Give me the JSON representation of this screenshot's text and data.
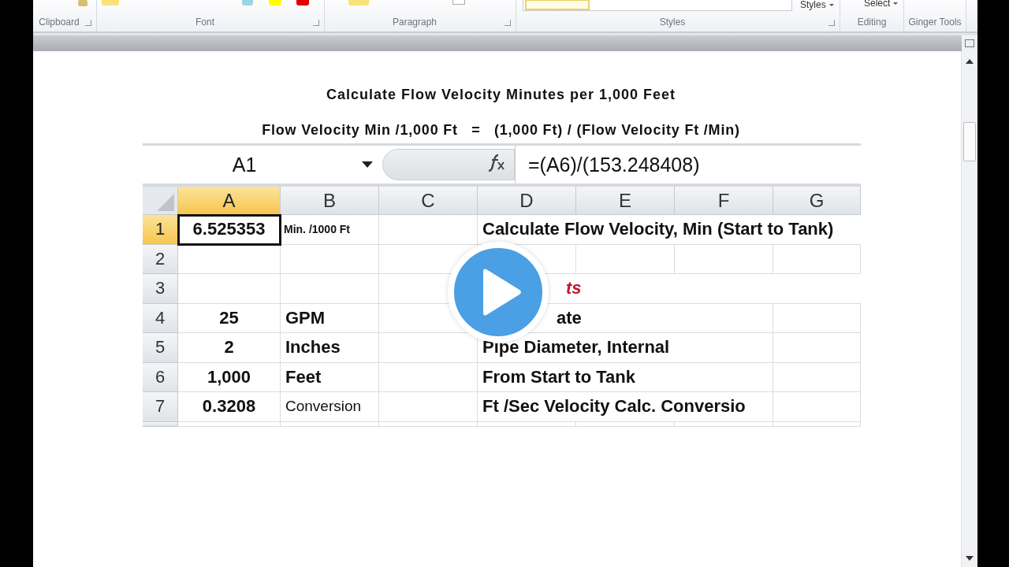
{
  "ribbon": {
    "top_buttons": [
      {
        "label": "Styles"
      },
      {
        "label": "Select"
      }
    ],
    "groups": [
      {
        "label": "Clipboard",
        "launcher": true
      },
      {
        "label": "Font",
        "launcher": true
      },
      {
        "label": "Paragraph",
        "launcher": true
      },
      {
        "label": "Styles",
        "launcher": true
      },
      {
        "label": "Editing",
        "launcher": false
      },
      {
        "label": "Ginger Tools",
        "launcher": false
      }
    ]
  },
  "document": {
    "title": "Calculate Flow Velocity Minutes per 1,000 Feet",
    "formula": "Flow Velocity Min /1,000 Ft   =   (1,000 Ft) / (Flow Velocity Ft /Min)"
  },
  "spreadsheet": {
    "name_box": "A1",
    "formula": "=(A6)/(153.248408)",
    "columns": [
      {
        "label": "A",
        "selected": true
      },
      {
        "label": "B",
        "selected": false
      },
      {
        "label": "C",
        "selected": false
      },
      {
        "label": "D",
        "selected": false
      },
      {
        "label": "E",
        "selected": false
      },
      {
        "label": "F",
        "selected": false
      },
      {
        "label": "G",
        "selected": false
      }
    ],
    "rows": [
      {
        "label": "1",
        "selected": true,
        "cells": {
          "A": {
            "text": "6.525353",
            "kind": "value",
            "selected": true
          },
          "B": {
            "text": "Min. /1000 Ft",
            "kind": "note",
            "selected": false
          },
          "D": {
            "text": "Calculate Flow Velocity, Min (Start to Tank)",
            "kind": "heading",
            "selected": false
          }
        }
      },
      {
        "label": "2",
        "selected": false,
        "cells": {}
      },
      {
        "label": "3",
        "selected": false,
        "cells": {
          "D": {
            "text": "ts",
            "kind": "accent",
            "selected": false
          }
        }
      },
      {
        "label": "4",
        "selected": false,
        "cells": {
          "A": {
            "text": "25",
            "kind": "value",
            "selected": false
          },
          "B": {
            "text": "GPM",
            "kind": "label",
            "selected": false
          },
          "D": {
            "text": "ate",
            "kind": "covered",
            "selected": false
          }
        }
      },
      {
        "label": "5",
        "selected": false,
        "cells": {
          "A": {
            "text": "2",
            "kind": "value",
            "selected": false
          },
          "B": {
            "text": "Inches",
            "kind": "label",
            "selected": false
          },
          "D": {
            "text": "Pipe Diameter, Internal",
            "kind": "label",
            "selected": false
          }
        }
      },
      {
        "label": "6",
        "selected": false,
        "cells": {
          "A": {
            "text": "1,000",
            "kind": "value",
            "selected": false
          },
          "B": {
            "text": "Feet",
            "kind": "label",
            "selected": false
          },
          "D": {
            "text": "From Start to Tank",
            "kind": "label",
            "selected": false
          }
        }
      },
      {
        "label": "7",
        "selected": false,
        "cells": {
          "A": {
            "text": "0.3208",
            "kind": "value",
            "selected": false
          },
          "B": {
            "text": "Conversion",
            "kind": "plain",
            "selected": false
          },
          "D": {
            "text": "Ft /Sec Velocity Calc. Conversio",
            "kind": "label",
            "selected": false
          }
        }
      }
    ]
  }
}
